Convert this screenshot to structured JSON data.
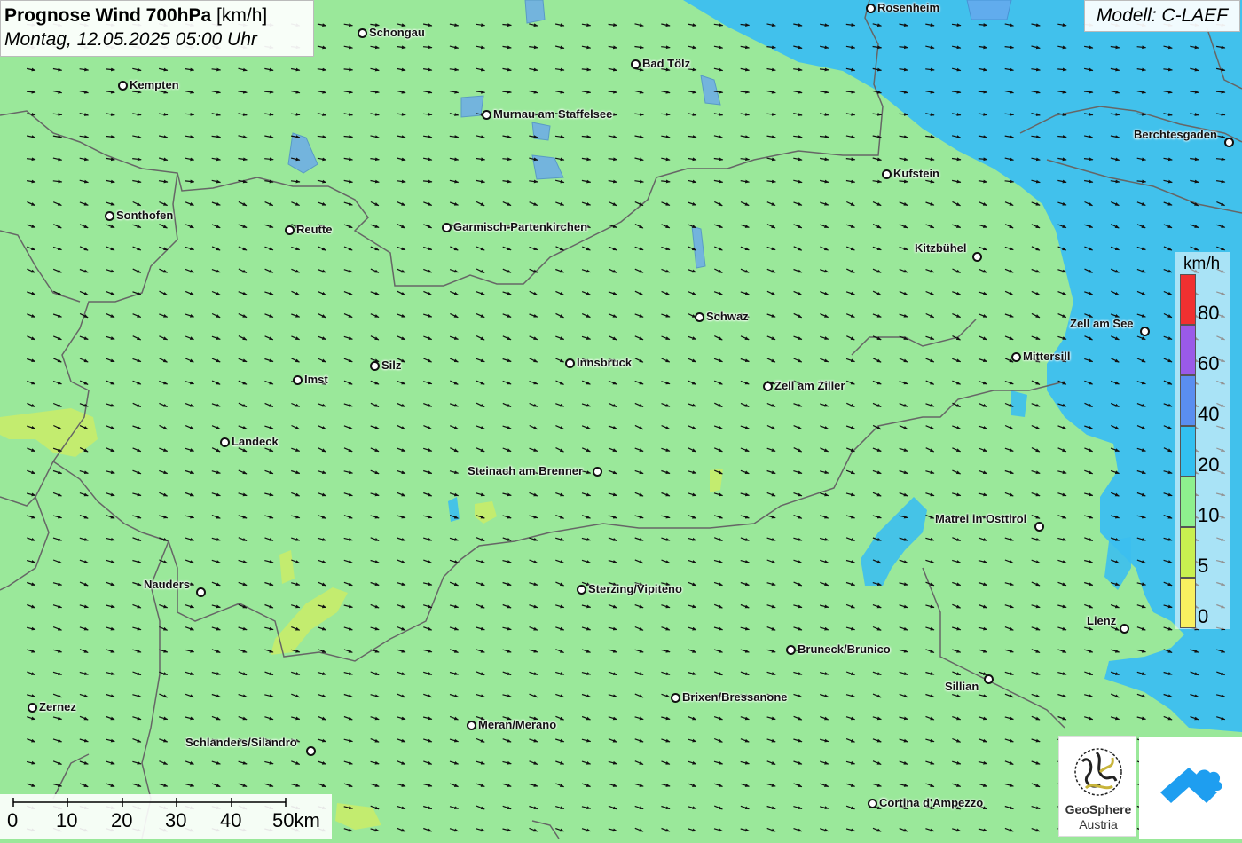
{
  "title": {
    "main": "Prognose Wind 700hPa",
    "unit": "[km/h]",
    "datetime": "Montag, 12.05.2025 05:00 Uhr"
  },
  "model_label": "Modell: C-LAEF",
  "legend": {
    "unit": "km/h",
    "labels": [
      "80",
      "60",
      "40",
      "20",
      "10",
      "5",
      "0"
    ],
    "colors": [
      "#f03030",
      "#9a5ae8",
      "#5a8ef0",
      "#32c0f0",
      "#8ef08e",
      "#c8f050",
      "#f8f060"
    ]
  },
  "scale_bar": {
    "labels": [
      "0",
      "10",
      "20",
      "30",
      "40",
      "50km"
    ]
  },
  "cities": [
    {
      "name": "Rosenheim"
    },
    {
      "name": "Schongau"
    },
    {
      "name": "Bad Tölz"
    },
    {
      "name": "Kempten"
    },
    {
      "name": "Murnau am Staffelsee"
    },
    {
      "name": "Berchtesgaden"
    },
    {
      "name": "Kufstein"
    },
    {
      "name": "Sonthofen"
    },
    {
      "name": "Reutte"
    },
    {
      "name": "Garmisch-Partenkirchen"
    },
    {
      "name": "Kitzbühel"
    },
    {
      "name": "Schwaz"
    },
    {
      "name": "Zell am See"
    },
    {
      "name": "Mittersill"
    },
    {
      "name": "Silz"
    },
    {
      "name": "Innsbruck"
    },
    {
      "name": "Imst"
    },
    {
      "name": "Zell am Ziller"
    },
    {
      "name": "Landeck"
    },
    {
      "name": "Steinach am Brenner"
    },
    {
      "name": "Matrei in Osttirol"
    },
    {
      "name": "Nauders"
    },
    {
      "name": "Sterzing/Vipiteno"
    },
    {
      "name": "Lienz"
    },
    {
      "name": "Bruneck/Brunico"
    },
    {
      "name": "Sillian"
    },
    {
      "name": "Brixen/Bressanone"
    },
    {
      "name": "Zernez"
    },
    {
      "name": "Meran/Merano"
    },
    {
      "name": "Schlanders/Silandro"
    },
    {
      "name": "Cortina d'Ampezzo"
    }
  ],
  "logos": {
    "geosphere_line1": "GeoSphere",
    "geosphere_line2": "Austria"
  },
  "colors": {
    "wind_10_20": "#9ae89a",
    "wind_20_40": "#3cbff0",
    "wind_5_10": "#c8ec6a",
    "borders": "#666666",
    "arrows": "#111111"
  }
}
